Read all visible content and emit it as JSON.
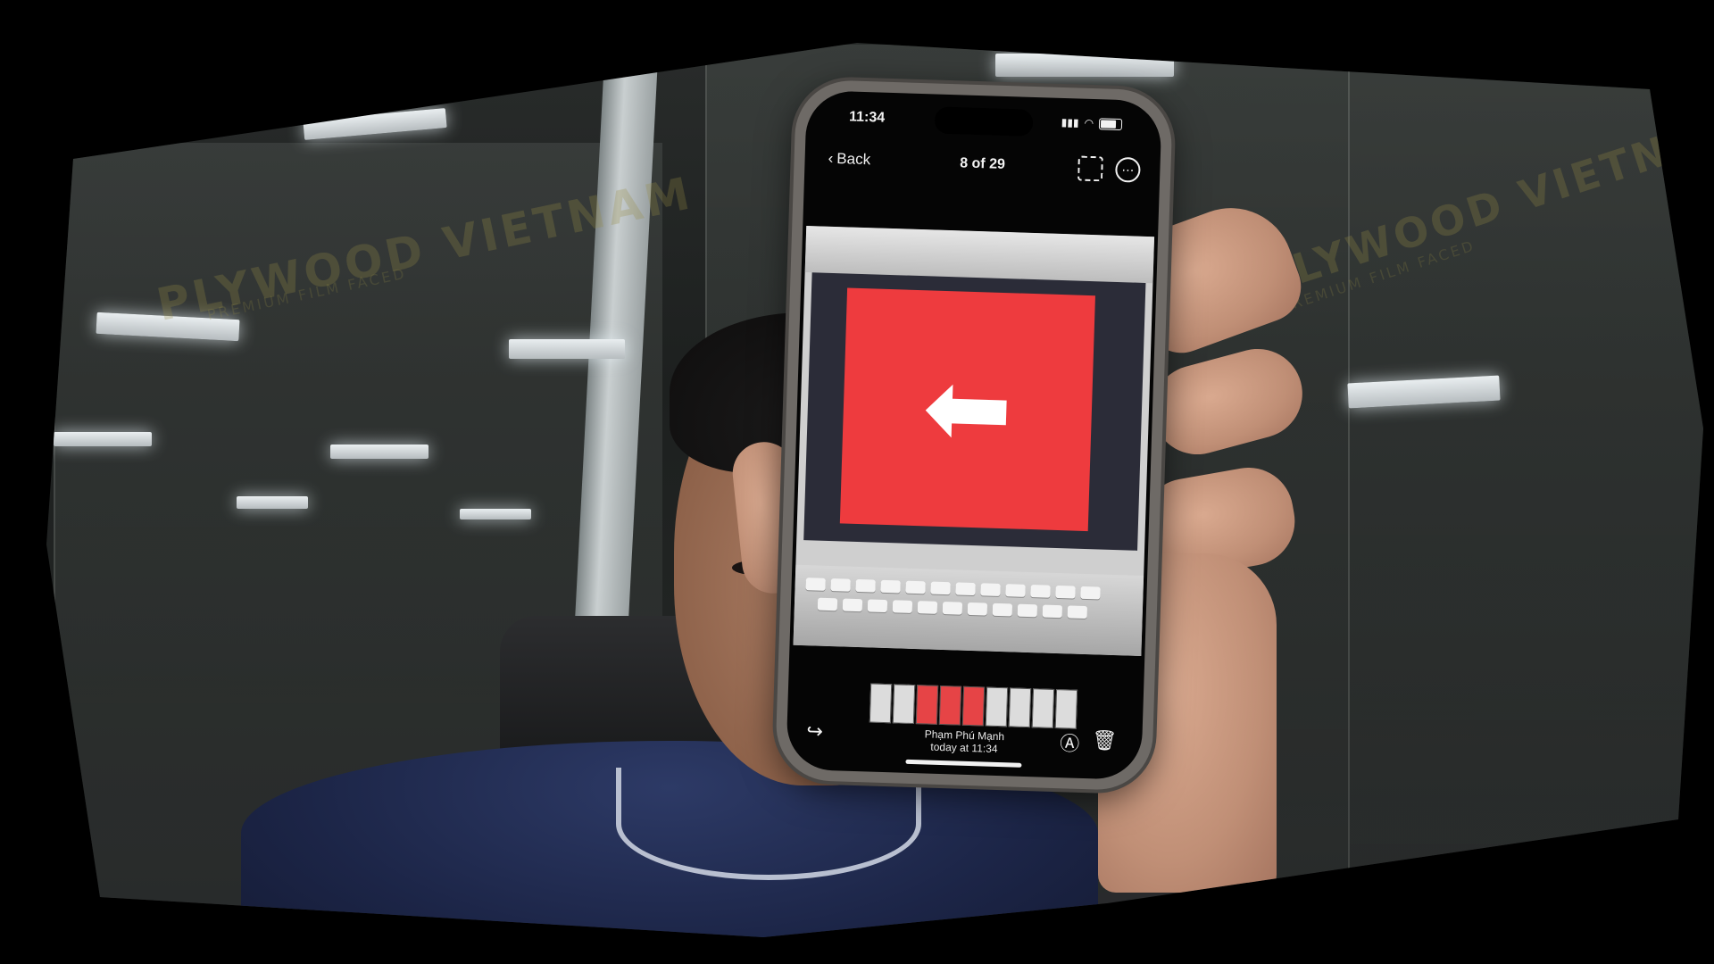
{
  "phone": {
    "status_time": "11:34",
    "back_label": "Back",
    "counter": "8 of 29",
    "owner_name": "Phạm Phú Mạnh",
    "timestamp": "today at 11:34",
    "arrow_icon": "arrow-left-icon",
    "accent_red": "#ee3b3e"
  },
  "watermark": {
    "brand": "PLYWOOD VIETNAM",
    "tagline": "PREMIUM FILM FACED"
  }
}
